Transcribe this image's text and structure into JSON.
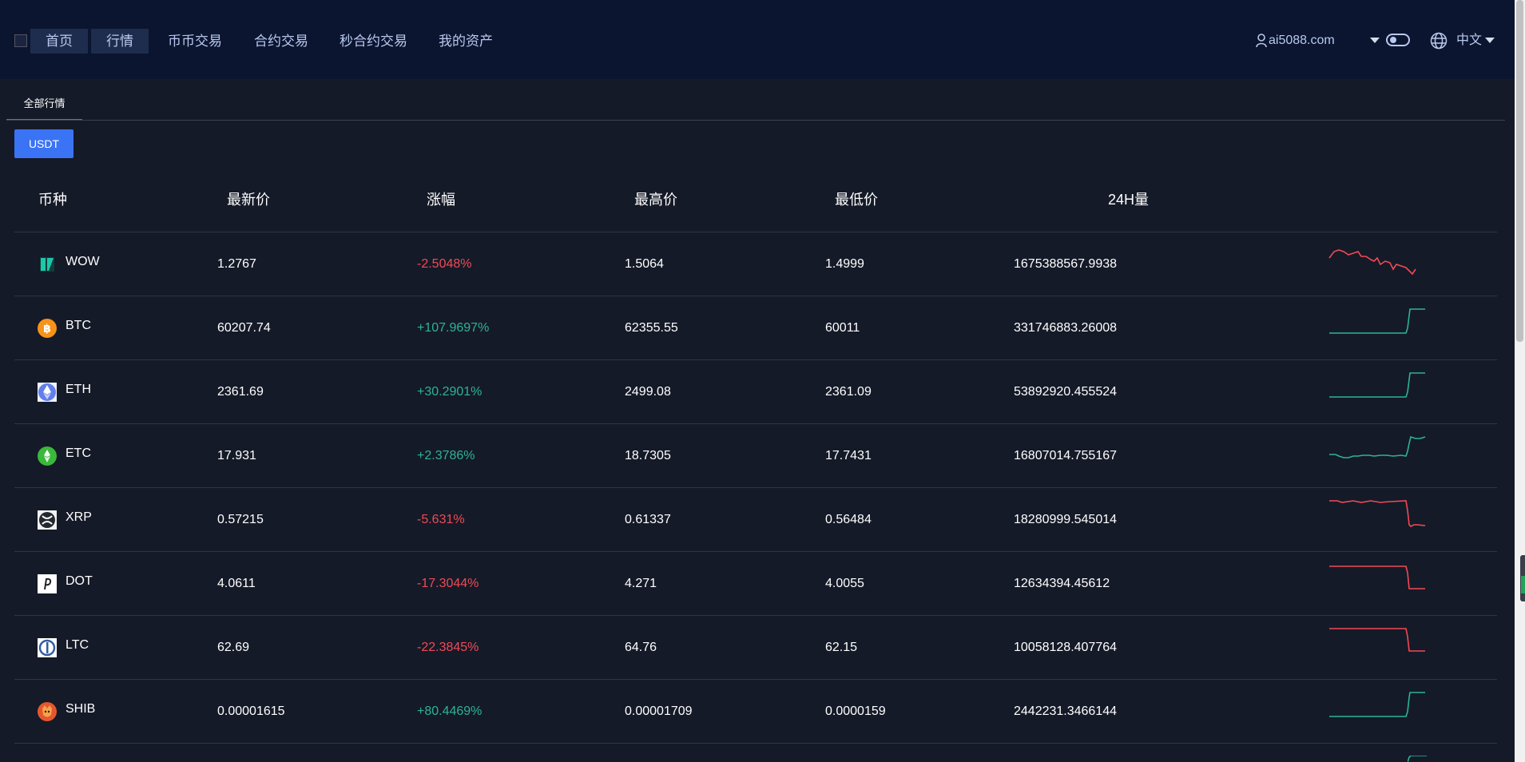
{
  "header": {
    "nav": [
      {
        "label": "首页"
      },
      {
        "label": "行情"
      },
      {
        "label": "币币交易"
      },
      {
        "label": "合约交易"
      },
      {
        "label": "秒合约交易"
      },
      {
        "label": "我的资产"
      }
    ],
    "account": "ai5088.com",
    "language": "中文"
  },
  "tabs": {
    "active": "全部行情"
  },
  "filter": {
    "usdt_label": "USDT"
  },
  "table": {
    "headers": {
      "coin": "币种",
      "last": "最新价",
      "change": "涨幅",
      "high": "最高价",
      "low": "最低价",
      "volume": "24H量"
    },
    "rows": [
      {
        "coin": "WOW",
        "last": "1.2767",
        "change": "-2.5048%",
        "high": "1.5064",
        "low": "1.4999",
        "volume": "1675388567.9938"
      },
      {
        "coin": "BTC",
        "last": "60207.74",
        "change": "+107.9697%",
        "high": "62355.55",
        "low": "60011",
        "volume": "331746883.26008"
      },
      {
        "coin": "ETH",
        "last": "2361.69",
        "change": "+30.2901%",
        "high": "2499.08",
        "low": "2361.09",
        "volume": "53892920.455524"
      },
      {
        "coin": "ETC",
        "last": "17.931",
        "change": "+2.3786%",
        "high": "18.7305",
        "low": "17.7431",
        "volume": "16807014.755167"
      },
      {
        "coin": "XRP",
        "last": "0.57215",
        "change": "-5.631%",
        "high": "0.61337",
        "low": "0.56484",
        "volume": "18280999.545014"
      },
      {
        "coin": "DOT",
        "last": "4.0611",
        "change": "-17.3044%",
        "high": "4.271",
        "low": "4.0055",
        "volume": "12634394.45612"
      },
      {
        "coin": "LTC",
        "last": "62.69",
        "change": "-22.3845%",
        "high": "64.76",
        "low": "62.15",
        "volume": "10058128.407764"
      },
      {
        "coin": "SHIB",
        "last": "0.00001615",
        "change": "+80.4469%",
        "high": "0.00001709",
        "low": "0.0000159",
        "volume": "2442231.3466144"
      }
    ]
  },
  "colors": {
    "up": "#2cb493",
    "down": "#f04a55",
    "accent": "#3b73f5"
  }
}
